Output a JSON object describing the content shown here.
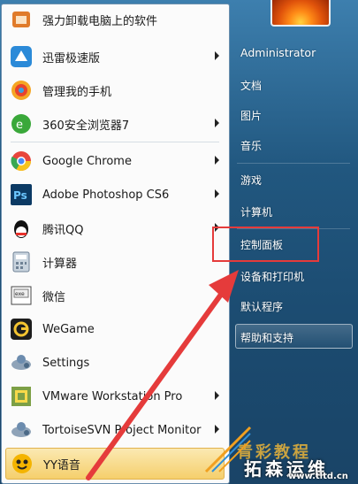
{
  "left_items": [
    {
      "label": "强力卸载电脑上的软件",
      "icon": "uninstall-icon",
      "color": "#d9822b",
      "submenu": false
    },
    {
      "label": "迅雷极速版",
      "icon": "thunder-icon",
      "color": "#2b8ad8",
      "submenu": true
    },
    {
      "label": "管理我的手机",
      "icon": "phone-manager-icon",
      "color": "#ea4a2a",
      "submenu": false
    },
    {
      "label": "360安全浏览器7",
      "icon": "browser-360-icon",
      "color": "#3aa83a",
      "submenu": true
    },
    {
      "label": "Google Chrome",
      "icon": "chrome-icon",
      "color": "#e8453c",
      "submenu": true
    },
    {
      "label": "Adobe Photoshop CS6",
      "icon": "photoshop-icon",
      "color": "#0c3a64",
      "submenu": true
    },
    {
      "label": "腾讯QQ",
      "icon": "qq-icon",
      "color": "#111111",
      "submenu": true
    },
    {
      "label": "计算器",
      "icon": "calculator-icon",
      "color": "#7a8fa3",
      "submenu": false
    },
    {
      "label": "微信",
      "icon": "wechat-icon",
      "color": "#ffffff",
      "submenu": false
    },
    {
      "label": "WeGame",
      "icon": "wegame-icon",
      "color": "#1d1d1d",
      "submenu": false
    },
    {
      "label": "Settings",
      "icon": "settings-icon",
      "color": "#5b7ea2",
      "submenu": false
    },
    {
      "label": "VMware Workstation Pro",
      "icon": "vmware-icon",
      "color": "#6d8f3b",
      "submenu": true
    },
    {
      "label": "TortoiseSVN Project Monitor",
      "icon": "tortoisesvn-icon",
      "color": "#5f8f56",
      "submenu": true
    },
    {
      "label": "YY语音",
      "icon": "yy-icon",
      "color": "#f4b400",
      "submenu": false
    }
  ],
  "right_items": [
    "Administrator",
    "文档",
    "图片",
    "音乐",
    "游戏",
    "计算机",
    "控制面板",
    "设备和打印机",
    "默认程序",
    "帮助和支持"
  ],
  "watermark": {
    "line1": "青彩教程",
    "line2": "拓森运维",
    "url": "www.tltd.cn"
  },
  "colors": {
    "highlight_box": "#e53b3b",
    "arrow": "#e53b3b"
  }
}
